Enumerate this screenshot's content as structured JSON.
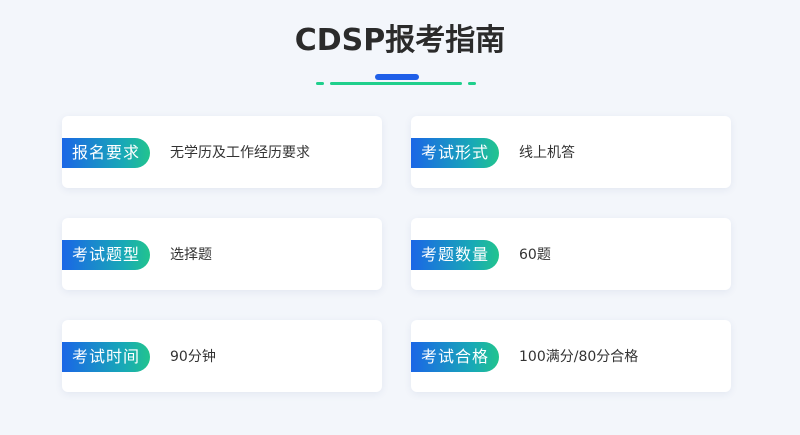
{
  "page": {
    "title": "CDSP报考指南"
  },
  "cards": [
    {
      "label": "报名要求",
      "value": "无学历及工作经历要求"
    },
    {
      "label": "考试形式",
      "value": "线上机答"
    },
    {
      "label": "考试题型",
      "value": "选择题"
    },
    {
      "label": "考题数量",
      "value": "60题"
    },
    {
      "label": "考试时间",
      "value": "90分钟"
    },
    {
      "label": "考试合格",
      "value": "100满分/80分合格"
    }
  ],
  "colors": {
    "accent_blue": "#1f5fe8",
    "accent_green": "#1fcf8c",
    "background": "#f3f6fb"
  }
}
